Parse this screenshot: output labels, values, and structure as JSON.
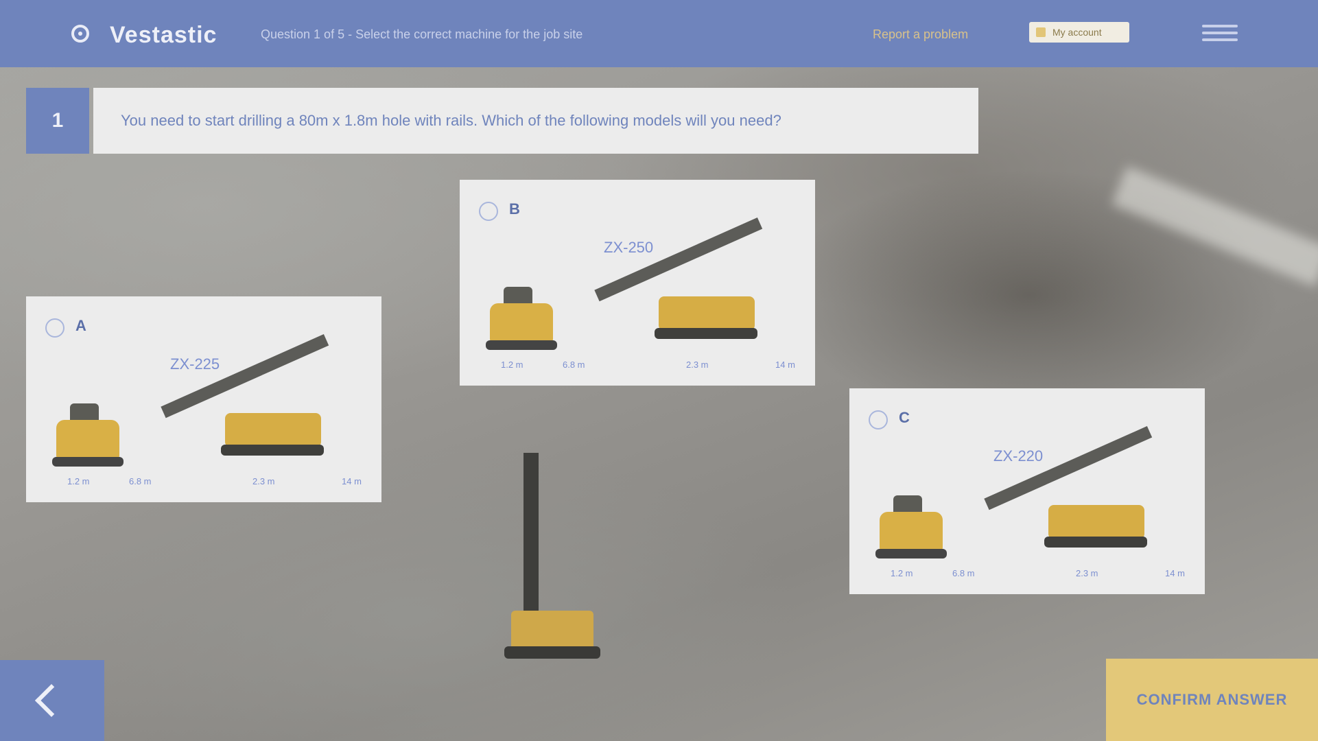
{
  "header": {
    "brand": "Vestastic",
    "subtitle": "Question 1 of 5 - Select the correct machine for the job site",
    "report_link": "Report a problem",
    "account_label": "My account",
    "accent_color": "#6f84bc"
  },
  "question": {
    "number": "1",
    "text": "You need to start drilling a 80m x 1.8m hole with rails. Which of the following models will you need?"
  },
  "options": [
    {
      "letter": "A",
      "model": "ZX-225",
      "dims": [
        "1.2 m",
        "6.8 m",
        "2.3 m",
        "14 m"
      ]
    },
    {
      "letter": "B",
      "model": "ZX-250",
      "dims": [
        "1.2 m",
        "6.8 m",
        "2.3 m",
        "14 m"
      ]
    },
    {
      "letter": "C",
      "model": "ZX-220",
      "dims": [
        "1.2 m",
        "6.8 m",
        "2.3 m",
        "14 m"
      ]
    }
  ],
  "footer": {
    "confirm_label": "CONFIRM ANSWER"
  },
  "icons": {
    "logo": "logo-icon",
    "menu": "menu-icon",
    "back": "chevron-left-icon",
    "radio": "radio-icon"
  }
}
